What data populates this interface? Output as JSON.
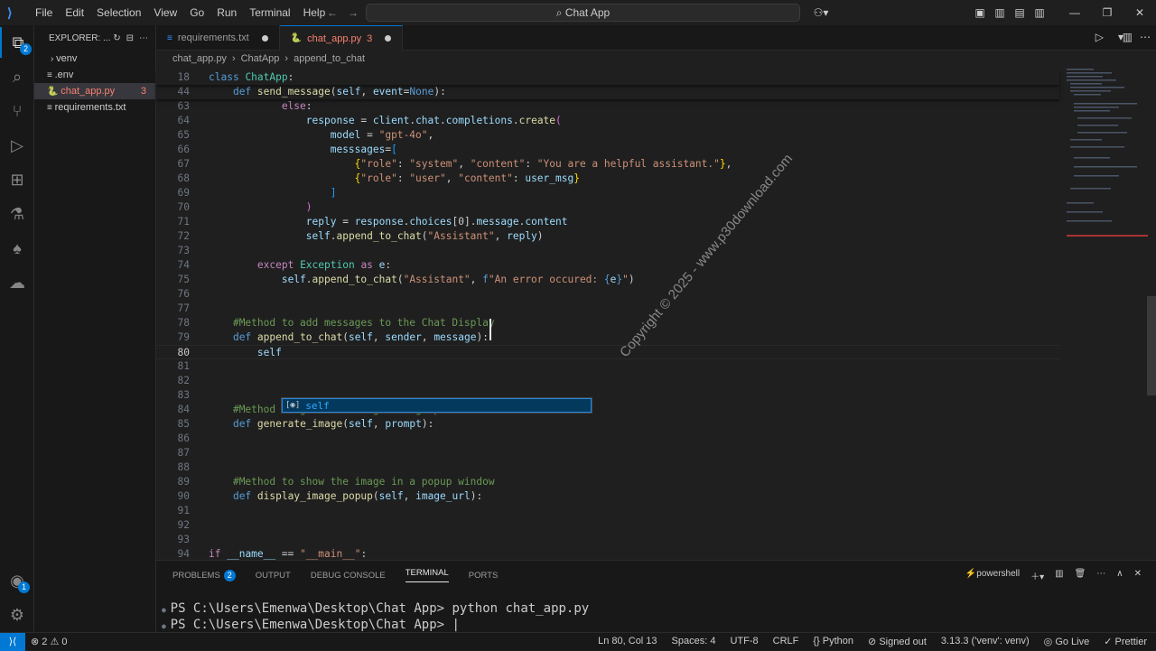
{
  "titlebar": {
    "menus": [
      "File",
      "Edit",
      "Selection",
      "View",
      "Go",
      "Run",
      "Terminal",
      "Help"
    ],
    "search": "Chat App"
  },
  "explorer": {
    "title": "EXPLORER: ...",
    "items": [
      {
        "label": "venv",
        "kind": "folder",
        "badge": ""
      },
      {
        "label": ".env",
        "kind": "file",
        "badge": ""
      },
      {
        "label": "chat_app.py",
        "kind": "file",
        "badge": "3",
        "selected": true
      },
      {
        "label": "requirements.txt",
        "kind": "file",
        "badge": ""
      }
    ]
  },
  "activity": {
    "explorer_badge": "2",
    "accounts_badge": "1"
  },
  "tabs": [
    {
      "label": "requirements.txt",
      "badge": "",
      "active": false
    },
    {
      "label": "chat_app.py",
      "badge": "3",
      "active": true
    }
  ],
  "breadcrumbs": [
    "chat_app.py",
    "ChatApp",
    "append_to_chat"
  ],
  "code": {
    "lines": [
      {
        "n": "18",
        "html": "<span class='kw'>class</span> <span class='cl'>ChatApp</span>:",
        "sticky": true
      },
      {
        "n": "44",
        "html": "    <span class='kw'>def</span> <span class='fn'>send_message</span>(<span class='pm'>self</span>, <span class='pm'>event</span>=<span class='kw'>None</span>):",
        "sticky": true
      },
      {
        "n": "63",
        "html": "            <span class='kw2'>else</span>:"
      },
      {
        "n": "64",
        "html": "                <span class='pm'>response</span> = <span class='pm'>client</span>.<span class='pm'>chat</span>.<span class='pm'>completions</span>.<span class='fn'>create</span><span class='br2'>(</span>"
      },
      {
        "n": "65",
        "html": "                    <span class='pm'>model</span> = <span class='st'>\"gpt-4o\"</span>,"
      },
      {
        "n": "66",
        "html": "                    <span class='pm'>messsages</span>=<span class='br3'>[</span>"
      },
      {
        "n": "67",
        "html": "                        <span class='br'>{</span><span class='st'>\"role\"</span>: <span class='st'>\"system\"</span>, <span class='st'>\"content\"</span>: <span class='st'>\"You are a helpful assistant.\"</span><span class='br'>}</span>,"
      },
      {
        "n": "68",
        "html": "                        <span class='br'>{</span><span class='st'>\"role\"</span>: <span class='st'>\"user\"</span>, <span class='st'>\"content\"</span>: <span class='pm'>user_msg</span><span class='br'>}</span>"
      },
      {
        "n": "69",
        "html": "                    <span class='br3'>]</span>"
      },
      {
        "n": "70",
        "html": "                <span class='br2'>)</span>"
      },
      {
        "n": "71",
        "html": "                <span class='pm'>reply</span> = <span class='pm'>response</span>.<span class='pm'>choices</span>[<span class='num'>0</span>].<span class='pm'>message</span>.<span class='pm'>content</span>"
      },
      {
        "n": "72",
        "html": "                <span class='pm'>self</span>.<span class='fn'>append_to_chat</span>(<span class='st'>\"Assistant\"</span>, <span class='pm'>reply</span>)"
      },
      {
        "n": "73",
        "html": ""
      },
      {
        "n": "74",
        "html": "        <span class='kw2'>except</span> <span class='cl'>Exception</span> <span class='kw2'>as</span> <span class='pm'>e</span>:"
      },
      {
        "n": "75",
        "html": "            <span class='pm'>self</span>.<span class='fn'>append_to_chat</span>(<span class='st'>\"Assistant\"</span>, <span class='kw'>f</span><span class='st'>\"An error occured: </span><span class='kw'>{</span><span class='pm'>e</span><span class='kw'>}</span><span class='st'>\"</span>)"
      },
      {
        "n": "76",
        "html": ""
      },
      {
        "n": "77",
        "html": ""
      },
      {
        "n": "78",
        "html": "    <span class='cm'>#Method to add messages to the Chat Display</span>"
      },
      {
        "n": "79",
        "html": "    <span class='kw'>def</span> <span class='fn'>append_to_chat</span>(<span class='pm'>self</span>, <span class='pm'>sender</span>, <span class='pm'>message</span>):"
      },
      {
        "n": "80",
        "html": "        <span class='pm'>self</span>",
        "current": true
      },
      {
        "n": "81",
        "html": ""
      },
      {
        "n": "82",
        "html": ""
      },
      {
        "n": "83",
        "html": ""
      },
      {
        "n": "84",
        "html": "    <span class='cm'>#Method to generate image using OpenAI DALL-E model</span>"
      },
      {
        "n": "85",
        "html": "    <span class='kw'>def</span> <span class='fn'>generate_image</span>(<span class='pm'>self</span>, <span class='pm'>prompt</span>):"
      },
      {
        "n": "86",
        "html": ""
      },
      {
        "n": "87",
        "html": ""
      },
      {
        "n": "88",
        "html": ""
      },
      {
        "n": "89",
        "html": "    <span class='cm'>#Method to show the image in a popup window</span>"
      },
      {
        "n": "90",
        "html": "    <span class='kw'>def</span> <span class='fn'>display_image_popup</span>(<span class='pm'>self</span>, <span class='pm'>image_url</span>):"
      },
      {
        "n": "91",
        "html": ""
      },
      {
        "n": "92",
        "html": ""
      },
      {
        "n": "93",
        "html": ""
      },
      {
        "n": "94",
        "html": "<span class='kw2'>if</span> <span class='pm'>__name__</span> == <span class='st'>\"__main__\"</span>:"
      }
    ]
  },
  "suggestion": {
    "label": "self"
  },
  "watermark": "Copyright © 2025 - www.p30download.com",
  "panel": {
    "tabs": [
      "PROBLEMS",
      "OUTPUT",
      "DEBUG CONSOLE",
      "TERMINAL",
      "PORTS"
    ],
    "problems_badge": "2",
    "shell": "powershell",
    "terminal_lines": [
      "PS C:\\Users\\Emenwa\\Desktop\\Chat App> python chat_app.py",
      "PS C:\\Users\\Emenwa\\Desktop\\Chat App> "
    ]
  },
  "statusbar": {
    "problems": "2",
    "warnings": "0",
    "position": "Ln 80, Col 13",
    "spaces": "Spaces: 4",
    "encoding": "UTF-8",
    "eol": "CRLF",
    "language": "Python",
    "account": "Signed out",
    "interpreter": "3.13.3 ('venv': venv)",
    "golive": "Go Live",
    "prettier": "Prettier"
  }
}
